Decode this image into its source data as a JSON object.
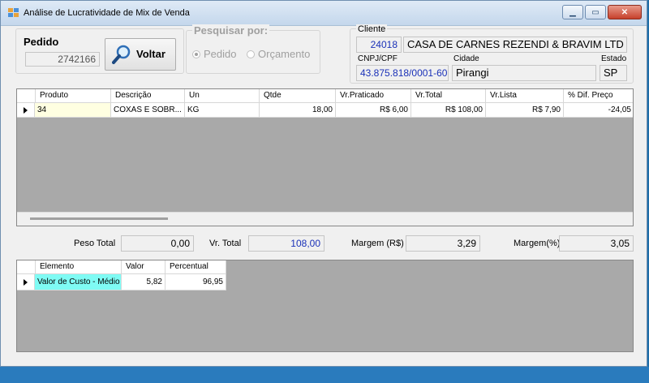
{
  "window": {
    "title": "Análise de Lucratividade de Mix de Venda"
  },
  "pedido": {
    "label": "Pedido",
    "value": "2742166"
  },
  "voltar": {
    "label": "Voltar"
  },
  "pesquisar": {
    "label": "Pesquisar por:",
    "options": [
      "Pedido",
      "Orçamento"
    ],
    "selected": "Pedido"
  },
  "cliente": {
    "label": "Cliente",
    "code": "24018",
    "name": "CASA DE CARNES REZENDI & BRAVIM LTD",
    "cnpj_label": "CNPJ/CPF",
    "cnpj": "43.875.818/0001-60",
    "cidade_label": "Cidade",
    "cidade": "Pirangi",
    "estado_label": "Estado",
    "estado": "SP"
  },
  "produtos": {
    "columns": [
      "Produto",
      "Descrição",
      "Un",
      "Qtde",
      "Vr.Praticado",
      "Vr.Total",
      "Vr.Lista",
      "% Dif. Preço"
    ],
    "rows": [
      {
        "produto": "34",
        "descricao": "COXAS E SOBR...",
        "un": "KG",
        "qtde": "18,00",
        "vr_praticado": "R$ 6,00",
        "vr_total": "R$ 108,00",
        "vr_lista": "R$ 7,90",
        "dif_preco": "-24,05"
      }
    ]
  },
  "totais": {
    "peso_label": "Peso Total",
    "peso": "0,00",
    "vr_total_label": "Vr. Total",
    "vr_total": "108,00",
    "margem_rs_label": "Margem (R$)",
    "margem_rs": "3,29",
    "margem_pct_label": "Margem(%)",
    "margem_pct": "3,05"
  },
  "elementos": {
    "columns": [
      "Elemento",
      "Valor",
      "Percentual"
    ],
    "rows": [
      {
        "elemento": "Valor de Custo - Médio",
        "valor": "5,82",
        "percentual": "96,95"
      }
    ]
  },
  "colors": {
    "highlight_yellow": "#ffffe1",
    "highlight_cyan": "#7ffbf4",
    "blue_text": "#1a31b8",
    "grid_bg": "#a9a9a9"
  }
}
